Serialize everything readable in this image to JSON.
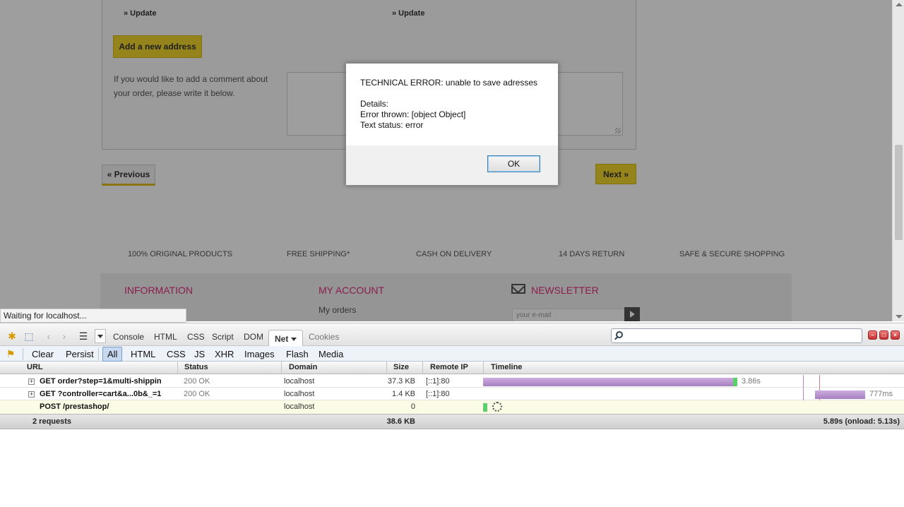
{
  "page": {
    "update_left": "» Update",
    "update_right": "» Update",
    "add_address_label": "Add a new address",
    "comment_text": "If you would like to add a comment about your order, please write it below.",
    "previous_label": "« Previous",
    "next_label": "Next »",
    "features": [
      "100% ORIGINAL PRODUCTS",
      "FREE SHIPPING*",
      "CASH ON DELIVERY",
      "14 DAYS RETURN",
      "SAFE & SECURE SHOPPING"
    ],
    "footer": {
      "information_title": "INFORMATION",
      "account_title": "MY ACCOUNT",
      "account_link": "My orders",
      "newsletter_title": "NEWSLETTER",
      "newsletter_placeholder": "your e-mail"
    },
    "accent_color": "#e0307c",
    "button_color": "#f1d52c"
  },
  "statusbar": {
    "text": "Waiting for localhost..."
  },
  "dialog": {
    "message": "TECHNICAL ERROR: unable to save adresses",
    "details_label": "Details:",
    "error_thrown": "Error thrown: [object Object]",
    "text_status": "Text status: error",
    "ok_label": "OK"
  },
  "firebug": {
    "tabs": [
      {
        "label": "Console"
      },
      {
        "label": "HTML"
      },
      {
        "label": "CSS"
      },
      {
        "label": "Script"
      },
      {
        "label": "DOM"
      },
      {
        "label": "Net"
      },
      {
        "label": "Cookies"
      }
    ],
    "active_tab": "Net",
    "filters": {
      "clear": "Clear",
      "persist": "Persist",
      "types": [
        "All",
        "HTML",
        "CSS",
        "JS",
        "XHR",
        "Images",
        "Flash",
        "Media"
      ],
      "active": "All"
    },
    "columns": {
      "url": "URL",
      "status": "Status",
      "domain": "Domain",
      "size": "Size",
      "remote_ip": "Remote IP",
      "timeline": "Timeline"
    },
    "requests": [
      {
        "url": "GET order?step=1&multi-shippin",
        "status": "200 OK",
        "domain": "localhost",
        "size": "37.3 KB",
        "ip": "[::1]:80",
        "time": "3.86s",
        "expandable": true
      },
      {
        "url": "GET ?controller=cart&a...0b&_=1",
        "status": "200 OK",
        "domain": "localhost",
        "size": "1.4 KB",
        "ip": "[::1]:80",
        "time": "777ms",
        "expandable": true
      },
      {
        "url": "POST /prestashop/",
        "status": "",
        "domain": "localhost",
        "size": "0",
        "ip": "",
        "time": "",
        "expandable": false
      }
    ],
    "summary": {
      "count": "2 requests",
      "total_size": "38.6 KB",
      "total_time": "5.89s (onload: 5.13s)"
    },
    "colors": {
      "bar": "#b48bc7",
      "bar_received": "#5ccf6d",
      "pending_row": "#fbfbe6"
    }
  }
}
